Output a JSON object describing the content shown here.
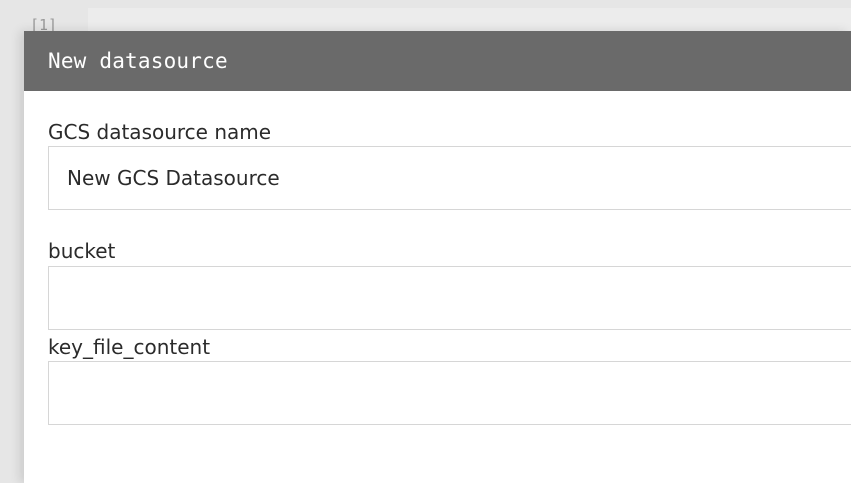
{
  "background": {
    "cell_prompt": "[1]"
  },
  "dialog": {
    "title": "New datasource",
    "fields": [
      {
        "label": "GCS datasource name",
        "value": "New GCS Datasource",
        "placeholder": ""
      },
      {
        "label": "bucket",
        "value": "",
        "placeholder": ""
      },
      {
        "label": "key_file_content",
        "value": "",
        "placeholder": ""
      }
    ]
  },
  "colors": {
    "header_bg": "#6a6a6a",
    "header_text": "#ffffff",
    "page_bg": "#e6e6e6",
    "input_border": "#d6d6d6"
  }
}
